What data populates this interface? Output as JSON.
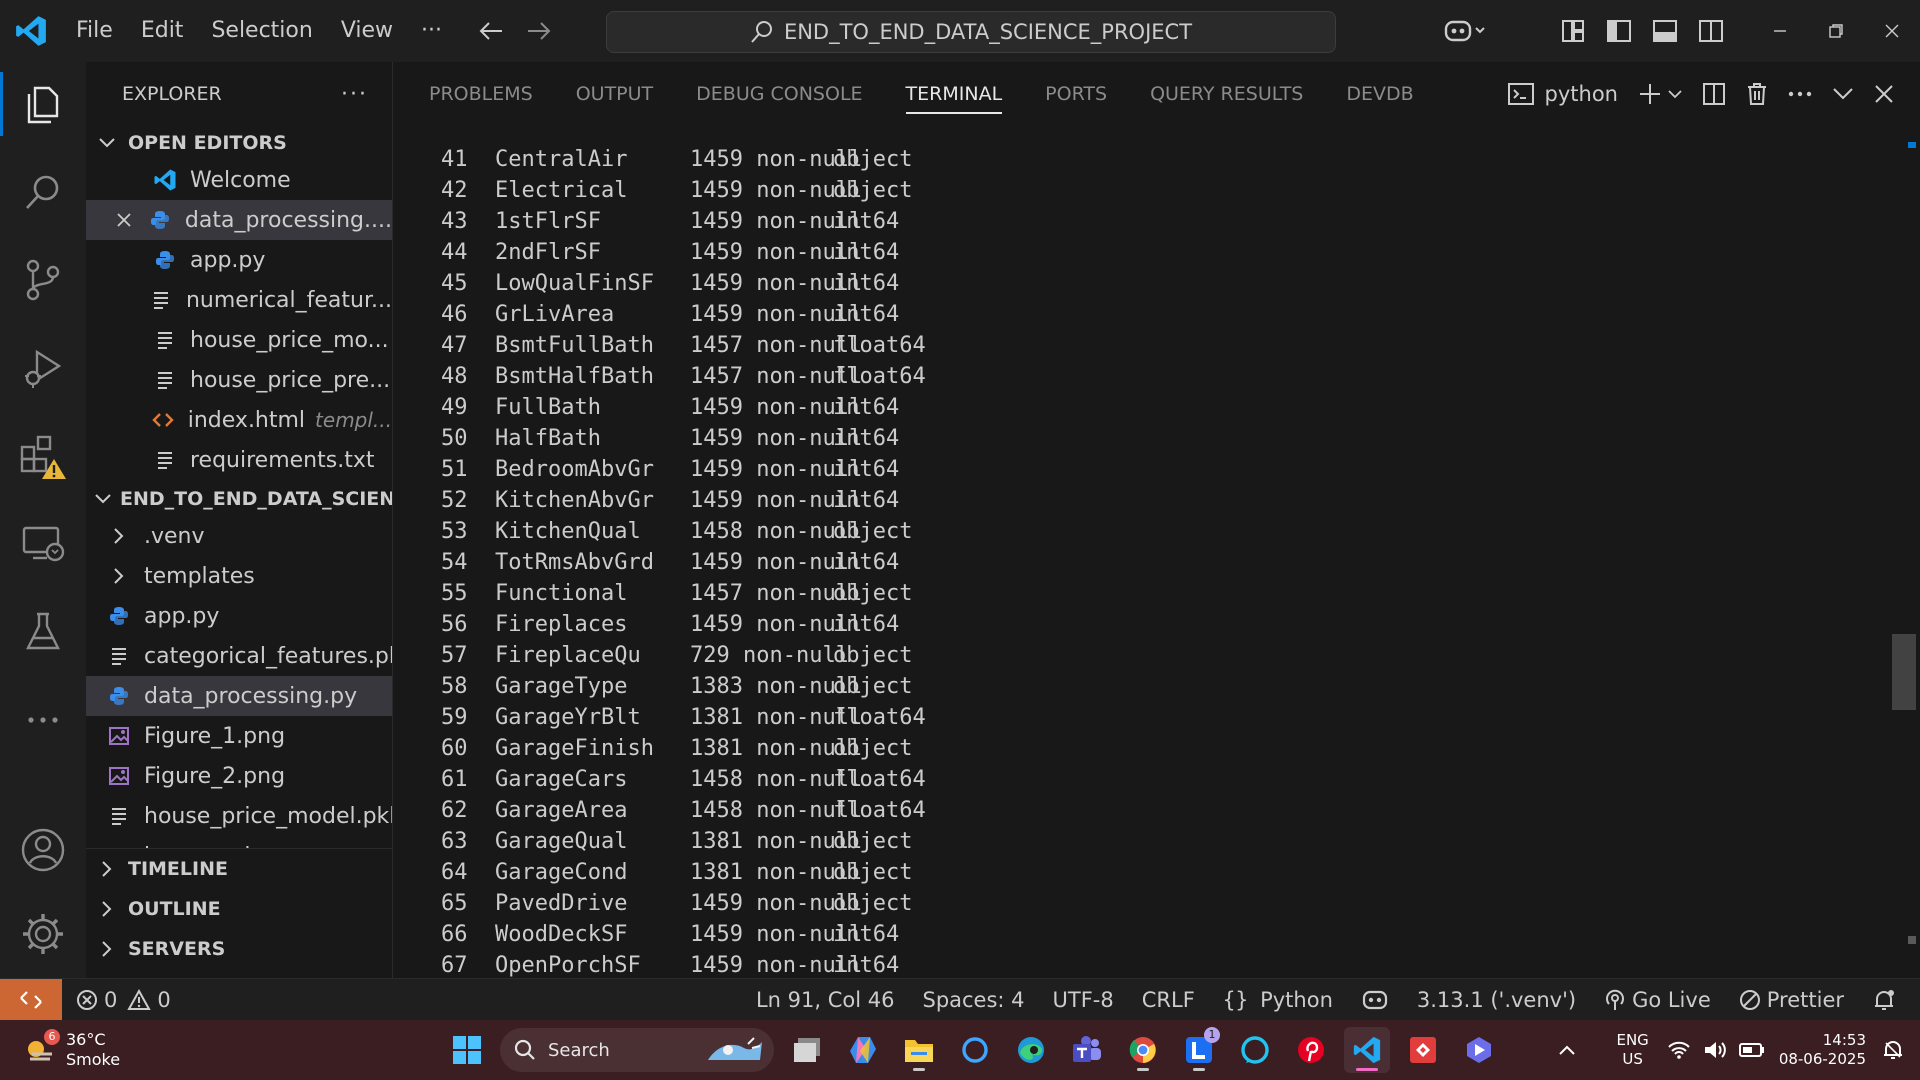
{
  "titlebar": {
    "menu": [
      "File",
      "Edit",
      "Selection",
      "View",
      "···"
    ],
    "search_text": "END_TO_END_DATA_SCIENCE_PROJECT"
  },
  "sidebar": {
    "title": "EXPLORER",
    "more": "···",
    "open_editors_label": "OPEN EDITORS",
    "open_editors": [
      {
        "name": "Welcome",
        "icon": "vscode-icon",
        "extra": ""
      },
      {
        "name": "data_processing....",
        "icon": "python-icon",
        "extra": "",
        "selected": true,
        "close": true
      },
      {
        "name": "app.py",
        "icon": "python-icon",
        "extra": ""
      },
      {
        "name": "numerical_featur...",
        "icon": "text-file-icon",
        "extra": ""
      },
      {
        "name": "house_price_mo...",
        "icon": "text-file-icon",
        "extra": ""
      },
      {
        "name": "house_price_pre...",
        "icon": "text-file-icon",
        "extra": ""
      },
      {
        "name": "index.html",
        "icon": "html-icon",
        "extra": "templ..."
      },
      {
        "name": "requirements.txt",
        "icon": "text-file-icon",
        "extra": ""
      }
    ],
    "project_label": "END_TO_END_DATA_SCIEN...",
    "project_items": [
      {
        "name": ".venv",
        "icon": "folder-chevron-icon"
      },
      {
        "name": "templates",
        "icon": "folder-chevron-icon"
      },
      {
        "name": "app.py",
        "icon": "python-icon"
      },
      {
        "name": "categorical_features.pkl",
        "icon": "text-file-icon"
      },
      {
        "name": "data_processing.py",
        "icon": "python-icon",
        "selected": true
      },
      {
        "name": "Figure_1.png",
        "icon": "image-icon"
      },
      {
        "name": "Figure_2.png",
        "icon": "image-icon"
      },
      {
        "name": "house_price_model.pkl",
        "icon": "text-file-icon"
      },
      {
        "name": "house_price_preproce...",
        "icon": "text-file-icon"
      }
    ],
    "timeline_label": "TIMELINE",
    "outline_label": "OUTLINE",
    "servers_label": "SERVERS"
  },
  "panel": {
    "tabs": [
      "PROBLEMS",
      "OUTPUT",
      "DEBUG CONSOLE",
      "TERMINAL",
      "PORTS",
      "QUERY RESULTS",
      "DEVDB"
    ],
    "active_tab": "TERMINAL",
    "terminal_name": "python",
    "lines": [
      [
        "41",
        "CentralAir",
        "1459 non-null",
        "object"
      ],
      [
        "42",
        "Electrical",
        "1459 non-null",
        "object"
      ],
      [
        "43",
        "1stFlrSF",
        "1459 non-null",
        "int64"
      ],
      [
        "44",
        "2ndFlrSF",
        "1459 non-null",
        "int64"
      ],
      [
        "45",
        "LowQualFinSF",
        "1459 non-null",
        "int64"
      ],
      [
        "46",
        "GrLivArea",
        "1459 non-null",
        "int64"
      ],
      [
        "47",
        "BsmtFullBath",
        "1457 non-null",
        "float64"
      ],
      [
        "48",
        "BsmtHalfBath",
        "1457 non-null",
        "float64"
      ],
      [
        "49",
        "FullBath",
        "1459 non-null",
        "int64"
      ],
      [
        "50",
        "HalfBath",
        "1459 non-null",
        "int64"
      ],
      [
        "51",
        "BedroomAbvGr",
        "1459 non-null",
        "int64"
      ],
      [
        "52",
        "KitchenAbvGr",
        "1459 non-null",
        "int64"
      ],
      [
        "53",
        "KitchenQual",
        "1458 non-null",
        "object"
      ],
      [
        "54",
        "TotRmsAbvGrd",
        "1459 non-null",
        "int64"
      ],
      [
        "55",
        "Functional",
        "1457 non-null",
        "object"
      ],
      [
        "56",
        "Fireplaces",
        "1459 non-null",
        "int64"
      ],
      [
        "57",
        "FireplaceQu",
        "729 non-null",
        "object"
      ],
      [
        "58",
        "GarageType",
        "1383 non-null",
        "object"
      ],
      [
        "59",
        "GarageYrBlt",
        "1381 non-null",
        "float64"
      ],
      [
        "60",
        "GarageFinish",
        "1381 non-null",
        "object"
      ],
      [
        "61",
        "GarageCars",
        "1458 non-null",
        "float64"
      ],
      [
        "62",
        "GarageArea",
        "1458 non-null",
        "float64"
      ],
      [
        "63",
        "GarageQual",
        "1381 non-null",
        "object"
      ],
      [
        "64",
        "GarageCond",
        "1381 non-null",
        "object"
      ],
      [
        "65",
        "PavedDrive",
        "1459 non-null",
        "object"
      ],
      [
        "66",
        "WoodDeckSF",
        "1459 non-null",
        "int64"
      ],
      [
        "67",
        "OpenPorchSF",
        "1459 non-null",
        "int64"
      ]
    ]
  },
  "statusbar": {
    "errors": "0",
    "warnings": "0",
    "position": "Ln 91, Col 46",
    "spaces": "Spaces: 4",
    "encoding": "UTF-8",
    "eol": "CRLF",
    "language": "Python",
    "interpreter": "3.13.1 ('.venv')",
    "golive": "Go Live",
    "prettier": "Prettier"
  },
  "taskbar": {
    "temperature": "36°C",
    "weather": "Smoke",
    "weather_badge": "6",
    "search_label": "Search",
    "lang1": "ENG",
    "lang2": "US",
    "time": "14:53",
    "date": "08-06-2025",
    "l_badge": "1"
  },
  "colors": {
    "accent": "#0078d4",
    "remote": "#cc6633",
    "python": "#3b8eea",
    "html": "#e37933",
    "image": "#a074c4"
  }
}
